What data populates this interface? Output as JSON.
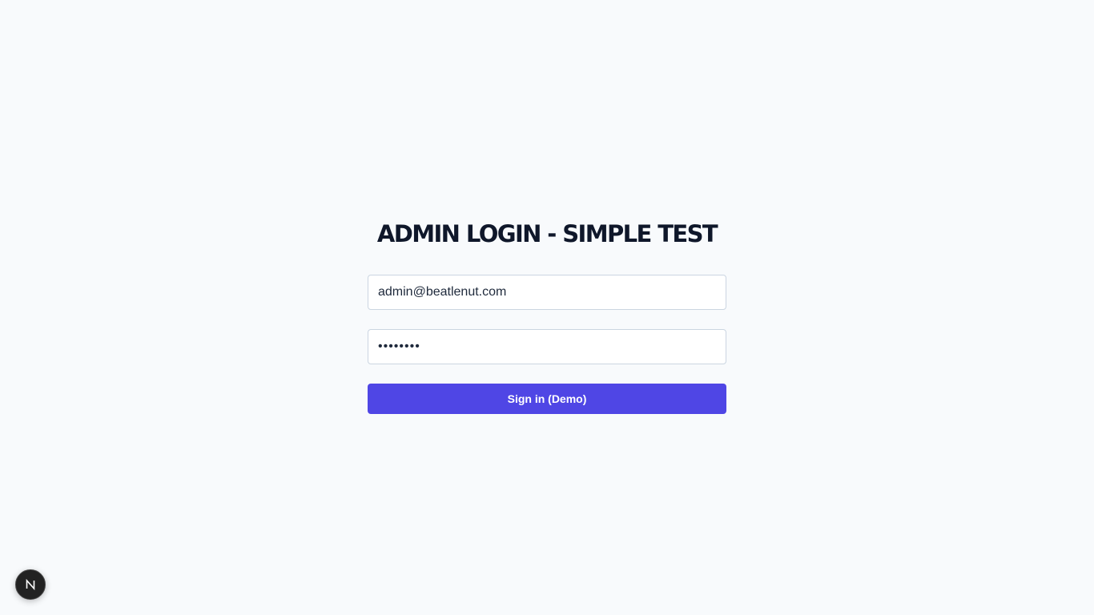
{
  "login": {
    "title": "ADMIN LOGIN - SIMPLE TEST",
    "email_value": "admin@beatlenut.com",
    "password_value": "password",
    "submit_label": "Sign in (Demo)"
  },
  "dev_badge": {
    "icon": "nextjs-logo-icon",
    "letter": "N"
  },
  "colors": {
    "background": "#f8fafc",
    "primary_button": "#4f46e5",
    "title_text": "#0f172a",
    "input_border": "#cbd5e1",
    "badge": "#222222"
  }
}
